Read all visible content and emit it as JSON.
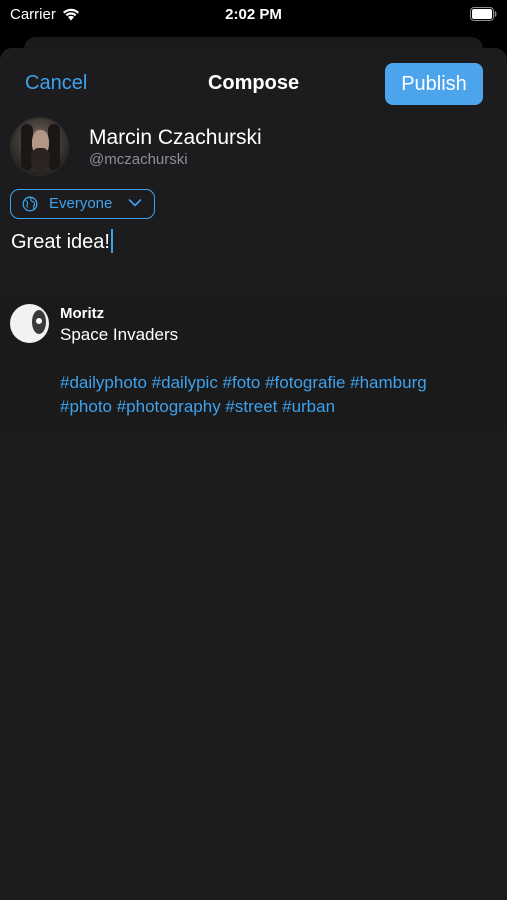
{
  "status_bar": {
    "carrier": "Carrier",
    "time": "2:02 PM",
    "icons": [
      "wifi-icon",
      "battery-icon"
    ]
  },
  "nav": {
    "cancel_label": "Cancel",
    "title": "Compose",
    "publish_label": "Publish"
  },
  "user": {
    "name": "Marcin Czachurski",
    "handle": "@mczachurski"
  },
  "visibility": {
    "label": "Everyone",
    "icon": "globe-icon"
  },
  "compose": {
    "text": "Great idea!"
  },
  "quoted_post": {
    "author": "Moritz",
    "text": "Space Invaders",
    "tags_line_1": "#dailyphoto #dailypic #foto #fotografie #hamburg",
    "tags_line_2": "#photo #photography #street #urban"
  },
  "colors": {
    "accent": "#3ea1ec",
    "publish_bg": "#4ba4ec",
    "sheet_bg": "#1c1c1e",
    "secondary_text": "#8e8e93"
  }
}
